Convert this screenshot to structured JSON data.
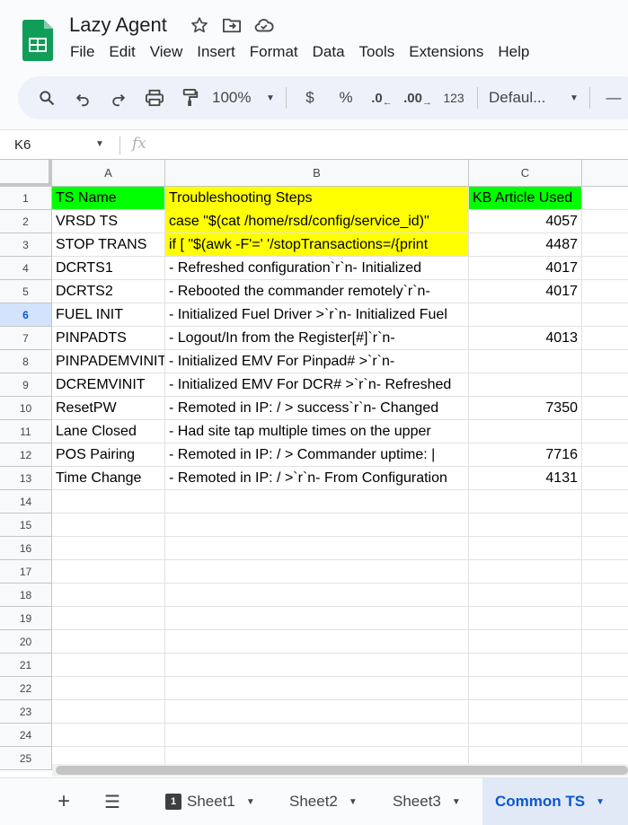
{
  "document": {
    "title": "Lazy Agent"
  },
  "menu": [
    "File",
    "Edit",
    "View",
    "Insert",
    "Format",
    "Data",
    "Tools",
    "Extensions",
    "Help"
  ],
  "toolbar": {
    "zoom": "100%",
    "currency": "$",
    "percent": "%",
    "decrease_decimal": ".0",
    "increase_decimal": ".00",
    "number_format": "123",
    "font": "Defaul..."
  },
  "formula_bar": {
    "cell_ref": "K6",
    "fx": "fx"
  },
  "grid": {
    "columns": [
      "A",
      "B",
      "C"
    ],
    "row_numbers": [
      "1",
      "2",
      "3",
      "4",
      "5",
      "6",
      "7",
      "8",
      "9",
      "10",
      "11",
      "12",
      "13",
      "14",
      "15",
      "16",
      "17",
      "18",
      "19",
      "20",
      "21",
      "22",
      "23",
      "24",
      "25"
    ],
    "active_row": "6",
    "rows": [
      {
        "a": "TS Name",
        "b": "Troubleshooting Steps",
        "c": "KB Article Used"
      },
      {
        "a": "VRSD TS",
        "b": "case \"$(cat /home/rsd/config/service_id)\"",
        "c": "4057"
      },
      {
        "a": "STOP TRANS",
        "b": "if [ \"$(awk -F'=' '/stopTransactions=/{print",
        "c": "4487"
      },
      {
        "a": "DCRTS1",
        "b": "- Refreshed configuration`r`n- Initialized",
        "c": "4017"
      },
      {
        "a": "DCRTS2",
        "b": "- Rebooted the commander remotely`r`n-",
        "c": "4017"
      },
      {
        "a": "FUEL INIT",
        "b": "- Initialized Fuel Driver >`r`n- Initialized Fuel",
        "c": ""
      },
      {
        "a": "PINPADTS",
        "b": "- Logout/In from the Register[#]`r`n-",
        "c": "4013"
      },
      {
        "a": "PINPADEMVINIT",
        "b": "- Initialized EMV For Pinpad# >`r`n-",
        "c": ""
      },
      {
        "a": "DCREMVINIT",
        "b": "- Initialized EMV For DCR# >`r`n- Refreshed",
        "c": ""
      },
      {
        "a": "ResetPW",
        "b": "- Remoted in IP: / > success`r`n- Changed",
        "c": "7350"
      },
      {
        "a": "Lane Closed",
        "b": "- Had site tap multiple times on the upper",
        "c": ""
      },
      {
        "a": "POS Pairing",
        "b": "- Remoted in IP: / > Commander uptime: |",
        "c": "7716"
      },
      {
        "a": "Time Change",
        "b": "- Remoted in IP: / >`r`n- From Configuration",
        "c": "4131"
      }
    ]
  },
  "sheets": [
    {
      "name": "Sheet1",
      "badge": "1",
      "active": false
    },
    {
      "name": "Sheet2",
      "active": false
    },
    {
      "name": "Sheet3",
      "active": false
    },
    {
      "name": "Common TS",
      "active": true
    }
  ],
  "colors": {
    "header_green": "#00ff00",
    "highlight_yellow": "#ffff00",
    "accent_blue": "#0b57d0"
  }
}
